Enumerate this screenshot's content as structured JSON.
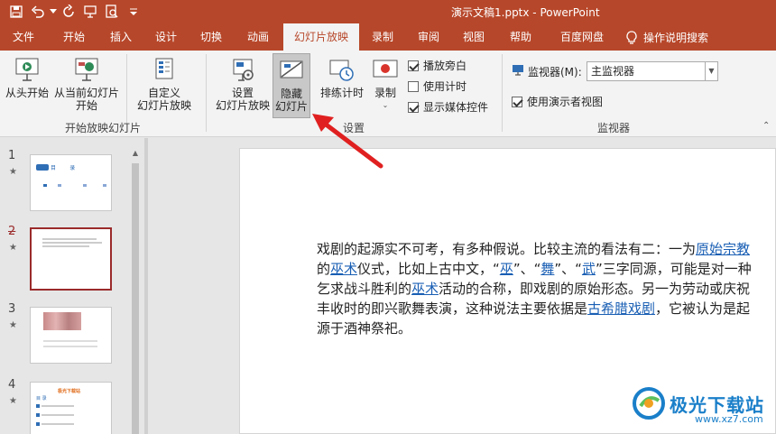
{
  "titlebar": {
    "title": "演示文稿1.pptx  -  PowerPoint",
    "qat": [
      "save-icon",
      "undo-icon",
      "redo-icon",
      "present-icon",
      "preview-icon",
      "customize-icon"
    ]
  },
  "tabs": [
    "文件",
    "开始",
    "插入",
    "设计",
    "切换",
    "动画",
    "幻灯片放映",
    "录制",
    "审阅",
    "视图",
    "帮助",
    "百度网盘"
  ],
  "active_tab": "幻灯片放映",
  "tell_me": "操作说明搜索",
  "ribbon": {
    "start": {
      "from_beginning": "从头开始",
      "from_current_l1": "从当前幻灯片",
      "from_current_l2": "开始",
      "custom_l1": "自定义",
      "custom_l2": "幻灯片放映",
      "group_label": "开始放映幻灯片"
    },
    "setup": {
      "setup_l1": "设置",
      "setup_l2": "幻灯片放映",
      "hide_l1": "隐藏",
      "hide_l2": "幻灯片",
      "rehearse": "排练计时",
      "record": "录制",
      "play_narration": "播放旁白",
      "use_timings": "使用计时",
      "show_media": "显示媒体控件",
      "group_label": "设置"
    },
    "monitors": {
      "monitor_label": "监视器(M):",
      "monitor_value": "主监视器",
      "presenter_view": "使用演示者视图",
      "group_label": "监视器"
    }
  },
  "thumbnails": [
    {
      "num": "1",
      "star": "★"
    },
    {
      "num": "2",
      "star": "★"
    },
    {
      "num": "3",
      "star": "★"
    },
    {
      "num": "4",
      "star": "★"
    }
  ],
  "thumb_text": {
    "t1_title": "目        录",
    "t4_title": "极光下载站",
    "t4_sub": "目 录"
  },
  "slide": {
    "p1": "戏剧的起源实不可考，有多种假说。比较主流的看法有二：一为",
    "l1": "原始宗教",
    "p2": "的",
    "l2": "巫术",
    "p3": "仪式，比如上古中文，“",
    "l3": "巫",
    "p4": "”、“",
    "l4": "舞",
    "p5": "”、“",
    "l5": "武",
    "p6": "”三字同源，可能是对一种乞求战斗胜利的",
    "l6": "巫术",
    "p7": "活动的合称，即戏剧的原始形态。另一为劳动或庆祝丰收时的即兴歌舞表演，这种说法主要依据是",
    "l7": "古希腊戏剧",
    "p8": "，它被认为是起源于酒神祭祀。"
  },
  "watermark": {
    "name": "极光下载站",
    "url": "www.xz7.com"
  },
  "colors": {
    "accent": "#b7472a",
    "link": "#1a5fb4",
    "arrow": "#e02020"
  }
}
